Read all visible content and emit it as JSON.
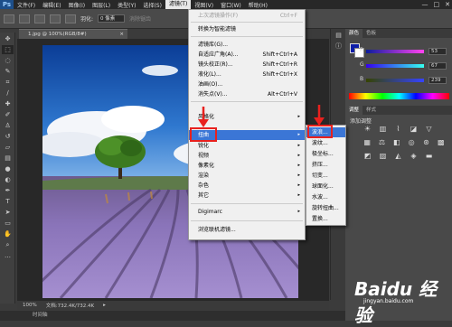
{
  "app": {
    "logo": "Ps"
  },
  "menubar": {
    "items": [
      "文件(F)",
      "编辑(E)",
      "图像(I)",
      "图层(L)",
      "类型(Y)",
      "选择(S)",
      "滤镜(T)",
      "视图(V)",
      "窗口(W)",
      "帮助(H)"
    ],
    "active": "滤镜(T)",
    "window_buttons": [
      "—",
      "□",
      "✕"
    ]
  },
  "options": {
    "feather_label": "羽化:",
    "feather_value": "0 像素",
    "antialias_label": "消除锯齿"
  },
  "document": {
    "tab_title": "1.jpg @ 100%(RGB/8#)",
    "close": "×",
    "zoom": "100%",
    "doc_info": "文档:732.4K/732.4K"
  },
  "timeline": {
    "label": "时间轴"
  },
  "filter_menu": {
    "items": [
      {
        "label": "上次滤镜操作(F)",
        "shortcut": "Ctrl+F",
        "disabled": true
      },
      {
        "label": "转换为智能滤镜",
        "shortcut": ""
      },
      {
        "label": "滤镜库(G)...",
        "shortcut": ""
      },
      {
        "label": "自适应广角(A)...",
        "shortcut": "Shift+Ctrl+A"
      },
      {
        "label": "镜头校正(R)...",
        "shortcut": "Shift+Ctrl+R"
      },
      {
        "label": "液化(L)...",
        "shortcut": "Shift+Ctrl+X"
      },
      {
        "label": "油画(O)...",
        "shortcut": ""
      },
      {
        "label": "消失点(V)...",
        "shortcut": "Alt+Ctrl+V"
      },
      {
        "label": "风格化",
        "sub": true
      },
      {
        "label": "扭曲",
        "sub": true,
        "highlighted": true
      },
      {
        "label": "锐化",
        "sub": true
      },
      {
        "label": "视频",
        "sub": true
      },
      {
        "label": "像素化",
        "sub": true
      },
      {
        "label": "渲染",
        "sub": true
      },
      {
        "label": "杂色",
        "sub": true
      },
      {
        "label": "其它",
        "sub": true
      },
      {
        "label": "Digimarc",
        "sub": true
      },
      {
        "label": "浏览联机滤镜...",
        "shortcut": ""
      }
    ]
  },
  "distort_menu": {
    "items": [
      "波浪...",
      "波纹...",
      "极坐标...",
      "挤压...",
      "切变...",
      "球面化...",
      "水波...",
      "旋转扭曲...",
      "置换..."
    ],
    "highlighted": "波浪..."
  },
  "color_panel": {
    "tabs": [
      "颜色",
      "色板"
    ],
    "channels": [
      {
        "name": "R",
        "value": "53"
      },
      {
        "name": "G",
        "value": "67"
      },
      {
        "name": "B",
        "value": "239"
      }
    ],
    "fg_color": "#0d1da7"
  },
  "adjust_panel": {
    "tabs": [
      "调整",
      "样式"
    ],
    "title": "添加调整"
  },
  "watermark": {
    "brand": "Baidu 经验",
    "url": "jingyan.baidu.com"
  }
}
